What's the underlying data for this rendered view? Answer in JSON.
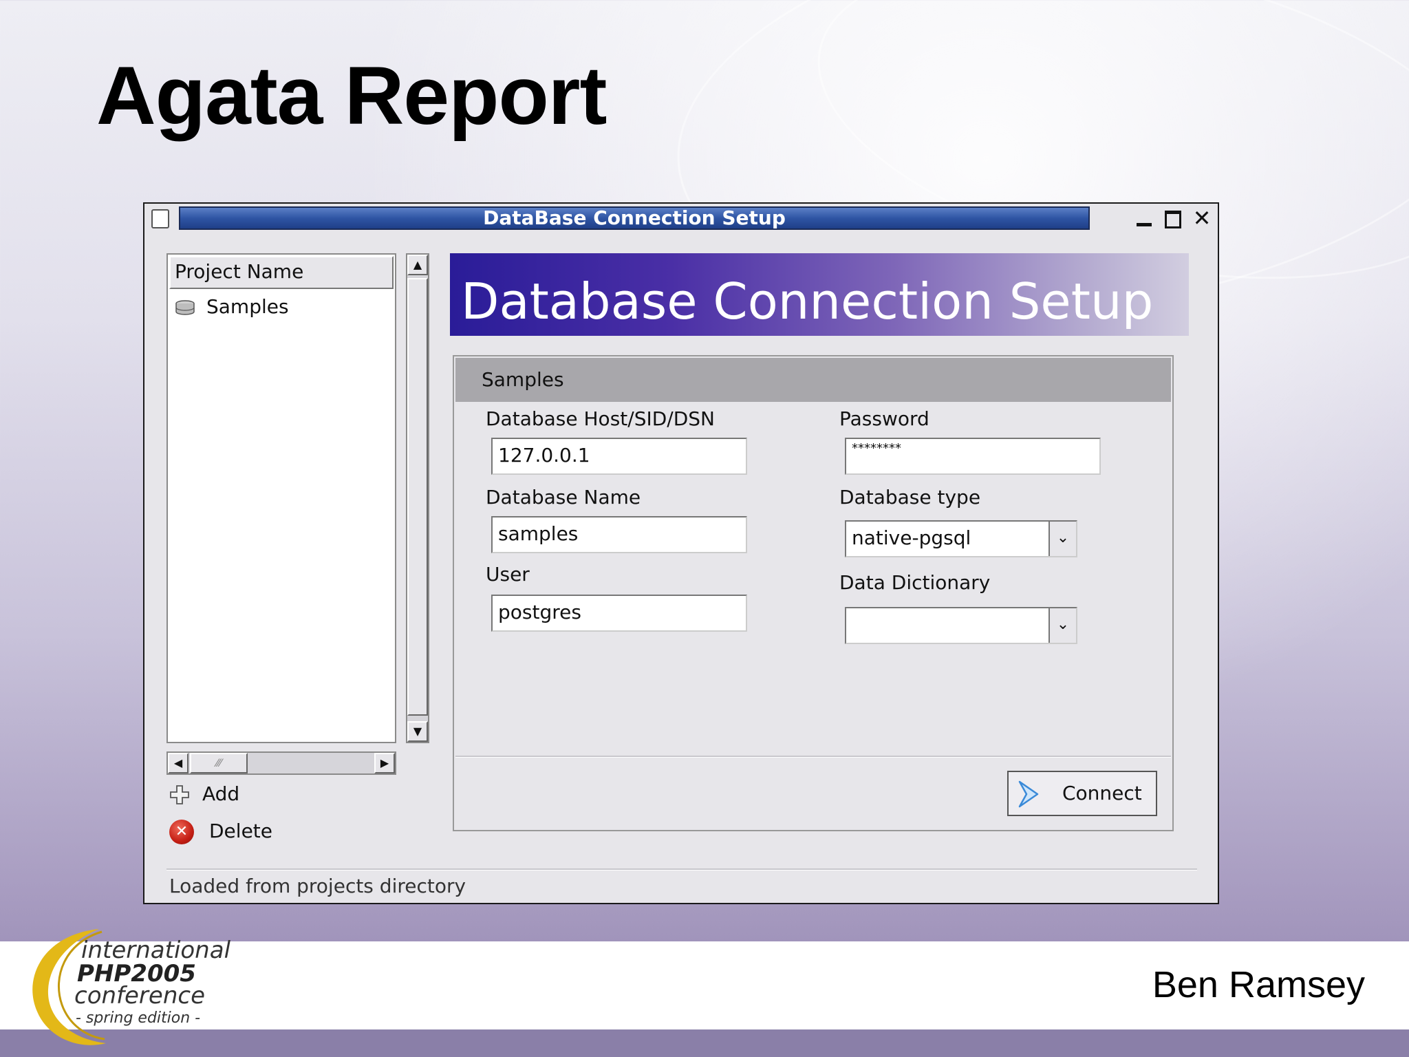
{
  "slide": {
    "title": "Agata Report",
    "author": "Ben Ramsey",
    "logo": {
      "line1": "international",
      "line2": "PHP2005",
      "line3": "conference",
      "line4": "- spring edition -"
    }
  },
  "window": {
    "title": "DataBase Connection Setup",
    "controls": [
      "minimize-icon",
      "maximize-icon",
      "close-icon"
    ]
  },
  "project_list": {
    "header": "Project Name",
    "items": [
      {
        "label": "Samples",
        "icon": "database-icon"
      }
    ],
    "add_label": "Add",
    "delete_label": "Delete"
  },
  "banner": {
    "title": "Database Connection Setup"
  },
  "form": {
    "header": "Samples",
    "host_label": "Database Host/SID/DSN",
    "host_value": "127.0.0.1",
    "name_label": "Database Name",
    "name_value": "samples",
    "user_label": "User",
    "user_value": "postgres",
    "password_label": "Password",
    "password_value": "********",
    "type_label": "Database type",
    "type_value": "native-pgsql",
    "dictionary_label": "Data Dictionary",
    "dictionary_value": "",
    "connect_label": "Connect"
  },
  "status": {
    "text": "Loaded from projects directory"
  }
}
